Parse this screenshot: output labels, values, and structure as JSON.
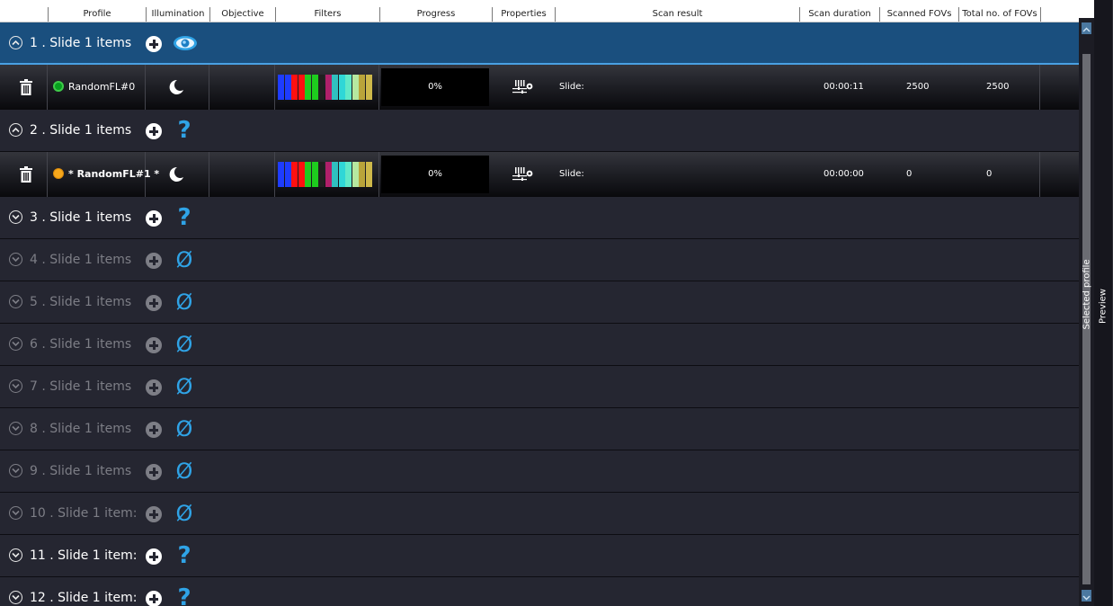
{
  "columns": [
    {
      "label": ""
    },
    {
      "label": "Profile"
    },
    {
      "label": "Illumination"
    },
    {
      "label": "Objective"
    },
    {
      "label": "Filters"
    },
    {
      "label": "Progress"
    },
    {
      "label": "Properties"
    },
    {
      "label": "Scan result"
    },
    {
      "label": "Scan duration"
    },
    {
      "label": "Scanned FOVs"
    },
    {
      "label": "Total no. of FOVs"
    }
  ],
  "slides": [
    {
      "title": "1 . Slide  1  items",
      "status_icon": "eye-icon",
      "status_symbol": "",
      "enabled": true,
      "selected": true,
      "expanded": true,
      "profile": {
        "indicator": "green",
        "name": "RandomFL#0",
        "illumination_icon": "moon-icon",
        "progress": "0%",
        "progress_value": 0,
        "scan_result": "Slide:",
        "scan_duration": "00:00:11",
        "scanned_fovs": "2500",
        "total_fovs": "2500"
      }
    },
    {
      "title": "2 . Slide  1  items",
      "status_icon": "question-icon",
      "status_symbol": "?",
      "enabled": true,
      "selected": false,
      "expanded": true,
      "profile": {
        "indicator": "orange",
        "name": "* RandomFL#1 *",
        "illumination_icon": "moon-icon",
        "progress": "0%",
        "progress_value": 0,
        "scan_result": "Slide:",
        "scan_duration": "00:00:00",
        "scanned_fovs": "0",
        "total_fovs": "0"
      }
    },
    {
      "title": "3 . Slide  1  items",
      "status_icon": "question-icon",
      "status_symbol": "?",
      "enabled": true,
      "selected": false,
      "expanded": false
    },
    {
      "title": "4 . Slide  1  items",
      "status_icon": "empty-set-icon",
      "status_symbol": "Ø",
      "enabled": false,
      "selected": false,
      "expanded": false
    },
    {
      "title": "5 . Slide  1  items",
      "status_icon": "empty-set-icon",
      "status_symbol": "Ø",
      "enabled": false,
      "selected": false,
      "expanded": false
    },
    {
      "title": "6 . Slide  1  items",
      "status_icon": "empty-set-icon",
      "status_symbol": "Ø",
      "enabled": false,
      "selected": false,
      "expanded": false
    },
    {
      "title": "7 . Slide  1  items",
      "status_icon": "empty-set-icon",
      "status_symbol": "Ø",
      "enabled": false,
      "selected": false,
      "expanded": false
    },
    {
      "title": "8 . Slide  1  items",
      "status_icon": "empty-set-icon",
      "status_symbol": "Ø",
      "enabled": false,
      "selected": false,
      "expanded": false
    },
    {
      "title": "9 . Slide  1  items",
      "status_icon": "empty-set-icon",
      "status_symbol": "Ø",
      "enabled": false,
      "selected": false,
      "expanded": false
    },
    {
      "title": "10 . Slide  1  item:",
      "status_icon": "empty-set-icon",
      "status_symbol": "Ø",
      "enabled": false,
      "selected": false,
      "expanded": false
    },
    {
      "title": "11 . Slide  1  item:",
      "status_icon": "question-icon",
      "status_symbol": "?",
      "enabled": true,
      "selected": false,
      "expanded": false
    },
    {
      "title": "12 . Slide  1  item:",
      "status_icon": "question-icon",
      "status_symbol": "?",
      "enabled": true,
      "selected": false,
      "expanded": false
    }
  ],
  "filter_colors": [
    "#1e3cff",
    "#1e3cff",
    "#ff1010",
    "#ff1010",
    "#1ecc1e",
    "#1ecc1e",
    "#202020",
    "#b0206a",
    "#30c0c0",
    "#2fd7d7",
    "#60e9c8",
    "#b6e8a0",
    "#b9a43a",
    "#cdb84a"
  ],
  "side_tabs": {
    "selected_profile": "Selected profile",
    "preview": "Preview"
  },
  "colors": {
    "accent": "#2fa3e6",
    "selected_row": "#1a4f7e",
    "background": "#252631",
    "disabled_text": "#7d7e86",
    "ready_indicator": "#06a01e",
    "pending_indicator": "#f7a81c"
  }
}
